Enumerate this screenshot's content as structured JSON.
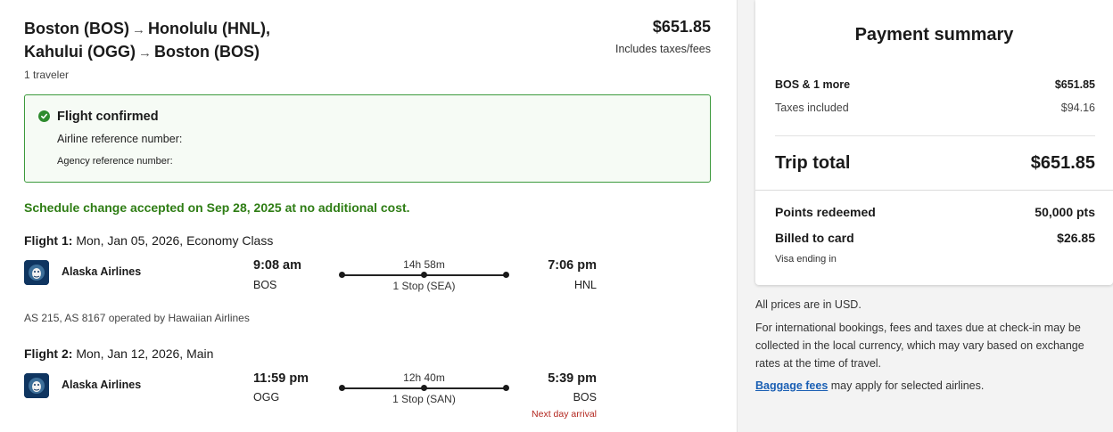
{
  "trip": {
    "route_line1_from": "Boston (BOS)",
    "route_line1_to": "Honolulu (HNL),",
    "route_line2_from": "Kahului (OGG)",
    "route_line2_to": "Boston (BOS)",
    "travelers": "1 traveler",
    "price": "$651.85",
    "price_note": "Includes taxes/fees"
  },
  "confirmation": {
    "title": "Flight confirmed",
    "airline_ref_label": "Airline reference number:",
    "agency_ref_label": "Agency reference number:"
  },
  "schedule_change": "Schedule change accepted on Sep 28, 2025 at no additional cost.",
  "flights": [
    {
      "label": "Flight 1:",
      "details": "Mon, Jan 05, 2026, Economy Class",
      "airline": "Alaska Airlines",
      "dep_time": "9:08 am",
      "dep_code": "BOS",
      "duration": "14h 58m",
      "stops": "1 Stop (SEA)",
      "arr_time": "7:06 pm",
      "arr_code": "HNL",
      "operated_by": "AS 215, AS 8167 operated by Hawaiian Airlines"
    },
    {
      "label": "Flight 2:",
      "details": "Mon, Jan 12, 2026, Main",
      "airline": "Alaska Airlines",
      "dep_time": "11:59 pm",
      "dep_code": "OGG",
      "duration": "12h 40m",
      "stops": "1 Stop (SAN)",
      "arr_time": "5:39 pm",
      "arr_code": "BOS",
      "arrival_note": "Next day arrival"
    }
  ],
  "summary": {
    "title": "Payment summary",
    "item_label": "BOS & 1 more",
    "item_value": "$651.85",
    "taxes_label": "Taxes included",
    "taxes_value": "$94.16",
    "total_label": "Trip total",
    "total_value": "$651.85",
    "points_label": "Points redeemed",
    "points_value": "50,000 pts",
    "billed_label": "Billed to card",
    "billed_value": "$26.85",
    "card_note": "Visa ending in"
  },
  "notes": {
    "usd": "All prices are in USD.",
    "international": "For international bookings, fees and taxes due at check-in may be collected in the local currency, which may vary based on exchange rates at the time of travel.",
    "baggage_link": "Baggage fees",
    "baggage_rest": " may apply for selected airlines."
  },
  "colors": {
    "confirm_green": "#3c9a3c",
    "schedule_green": "#2e7d14",
    "next_day_red": "#b3261e",
    "link_blue": "#1a5fb4",
    "logo_navy": "#0f3560"
  },
  "icons": [
    "check-circle-icon",
    "arrow-right-icon",
    "alaska-airlines-logo"
  ]
}
